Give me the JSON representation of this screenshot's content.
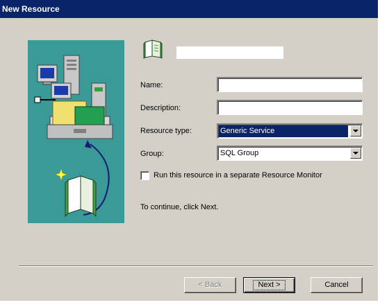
{
  "window": {
    "title": "New Resource"
  },
  "colors": {
    "title_bar": "#0a246a",
    "dialog_face": "#d4d0c8",
    "art_panel": "#3a9a98",
    "selection": "#0a246a"
  },
  "form": {
    "name": {
      "label": "Name:",
      "value": ""
    },
    "description": {
      "label": "Description:",
      "value": ""
    },
    "resource_type": {
      "label": "Resource type:",
      "value": "Generic Service"
    },
    "group": {
      "label": "Group:",
      "value": "SQL Group"
    },
    "separate_monitor": {
      "label": "Run this resource in a separate Resource Monitor",
      "checked": false
    }
  },
  "instruction": "To continue, click Next.",
  "buttons": {
    "back": "< Back",
    "next": "Next >",
    "cancel": "Cancel"
  },
  "icons": {
    "wizard": "open-book-icon",
    "illustration": "cluster-computers-and-folder-icon"
  }
}
